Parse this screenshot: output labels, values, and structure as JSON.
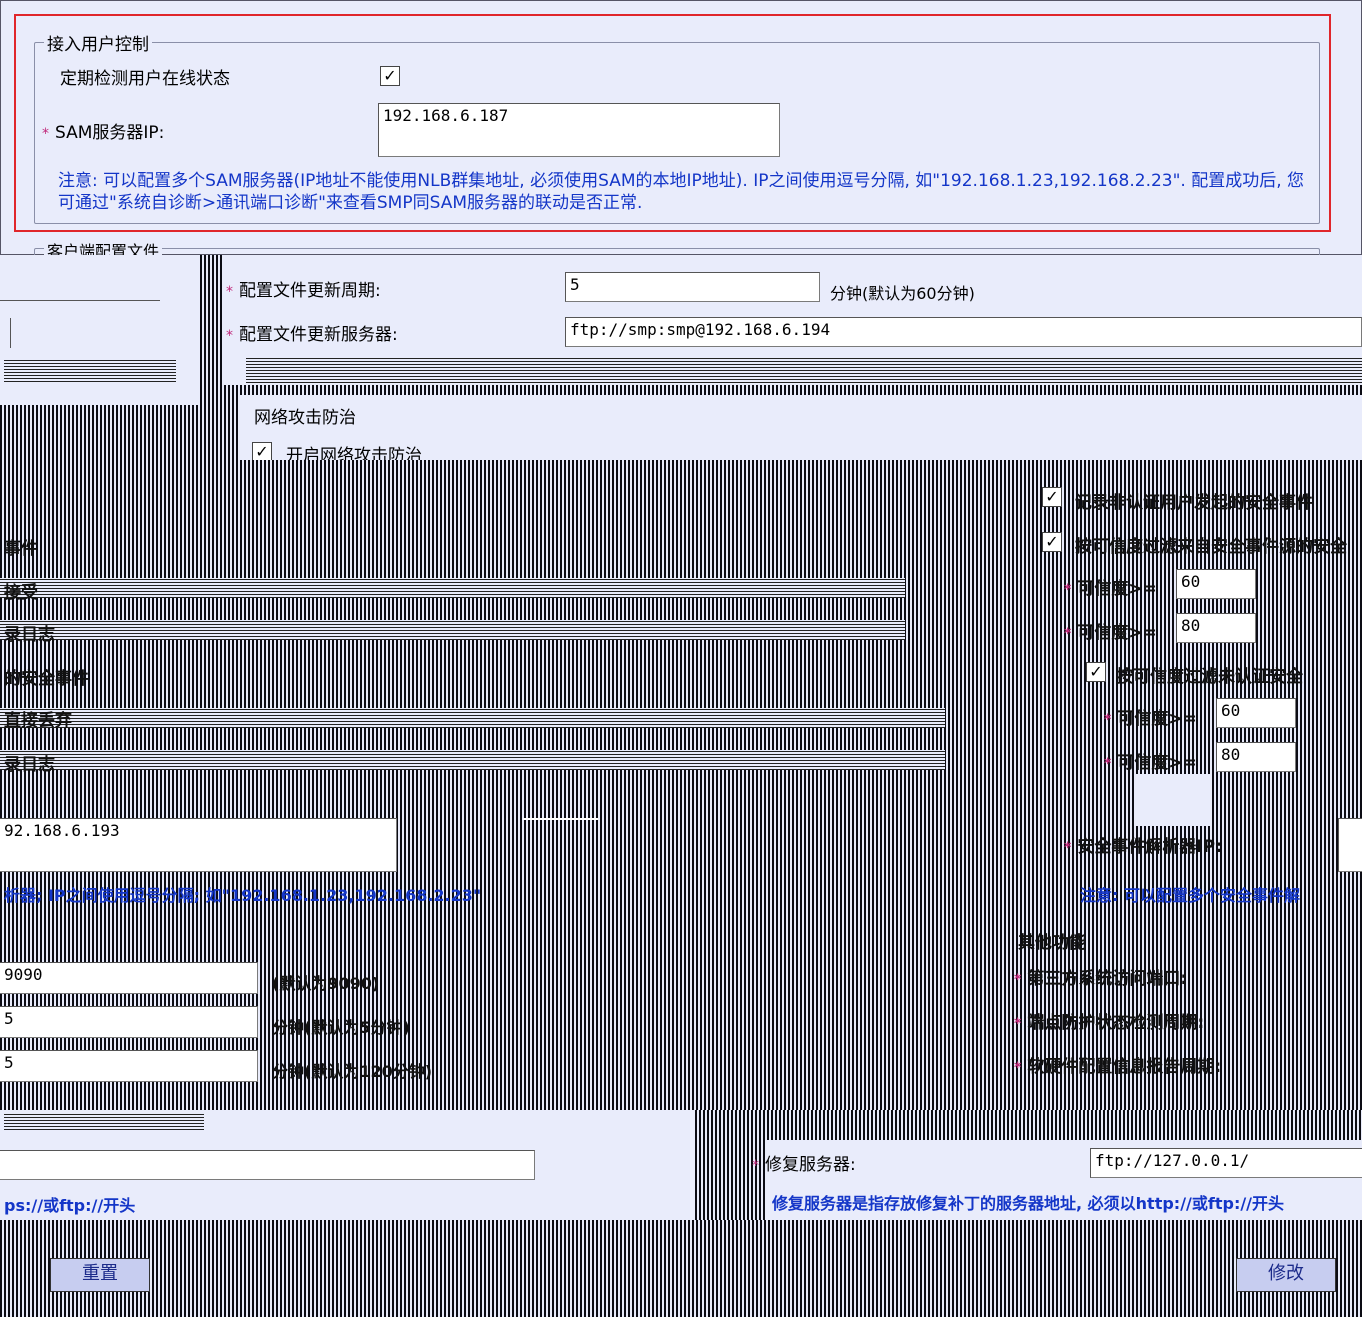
{
  "access_control": {
    "legend": "接入用户控制",
    "check_online_label": "定期检测用户在线状态",
    "check_online_checked": true,
    "sam_ip_label": "SAM服务器IP:",
    "sam_ip_value": "192.168.6.187",
    "note": "注意: 可以配置多个SAM服务器(IP地址不能使用NLB群集地址, 必须使用SAM的本地IP地址). IP之间使用逗号分隔, 如\"192.168.1.23,192.168.2.23\". 配置成功后, 您可通过\"系统自诊断>通讯端口诊断\"来查看SMP同SAM服务器的联动是否正常."
  },
  "client_config": {
    "legend": "客户端配置文件",
    "update_period_label": "配置文件更新周期:",
    "update_period_value": "5",
    "update_period_unit": "分钟(默认为60分钟)",
    "update_server_label": "配置文件更新服务器:",
    "update_server_value": "ftp://smp:smp@192.168.6.194"
  },
  "network_attack": {
    "legend": "网络攻击防治",
    "enable_label": "开启网络攻击防治",
    "enable_checked": true
  },
  "security_events": {
    "record_unauth_label": "记录非认证用户发起的安全事件",
    "record_unauth_checked": true,
    "filter_label": "按可信度过滤来自安全事件源的安全",
    "filter_checked": true,
    "confidence_label": "可信度>=",
    "conf1_value": "60",
    "conf2_value": "80",
    "filter2_label": "按可信度过滤未认证安全",
    "filter2_checked": true,
    "conf3_value": "60",
    "conf4_value": "80",
    "analyzer_ip_label": "安全事件解析器IP:",
    "analyzer_note": "注意: 可以配置多个安全事件解",
    "left_fragment_1": "事件",
    "left_fragment_2": "接受",
    "left_fragment_3": "录日志",
    "left_fragment_4": "的安全事件",
    "left_fragment_5": "直接丢弃",
    "left_fragment_6": "录日志",
    "left_ip_value": "92.168.6.193",
    "left_note": "析器; IP之间使用逗号分隔; 如\"192.168.1.23,192.168.2.23\""
  },
  "ports": {
    "port_value": "9090",
    "port_note": "(默认为9090)",
    "v2_value": "5",
    "v2_note": "分钟(默认为5分钟)",
    "v3_value": "5",
    "v3_note": "分钟(默认为120分钟)"
  },
  "other": {
    "legend": "其他功能",
    "third_party_label": "第三方系统访问端口:",
    "endpoint_label": "端点防护状态检测周期:",
    "hw_report_label": "软硬件配置信息报告周期:",
    "repair_server_label": "修复服务器:",
    "repair_server_value": "ftp://127.0.0.1/",
    "repair_note": "修复服务器是指存放修复补丁的服务器地址, 必须以http://或ftp://开头",
    "left_note": "ps://或ftp://开头"
  },
  "buttons": {
    "reset_label": "重置",
    "modify_label": "修改"
  }
}
